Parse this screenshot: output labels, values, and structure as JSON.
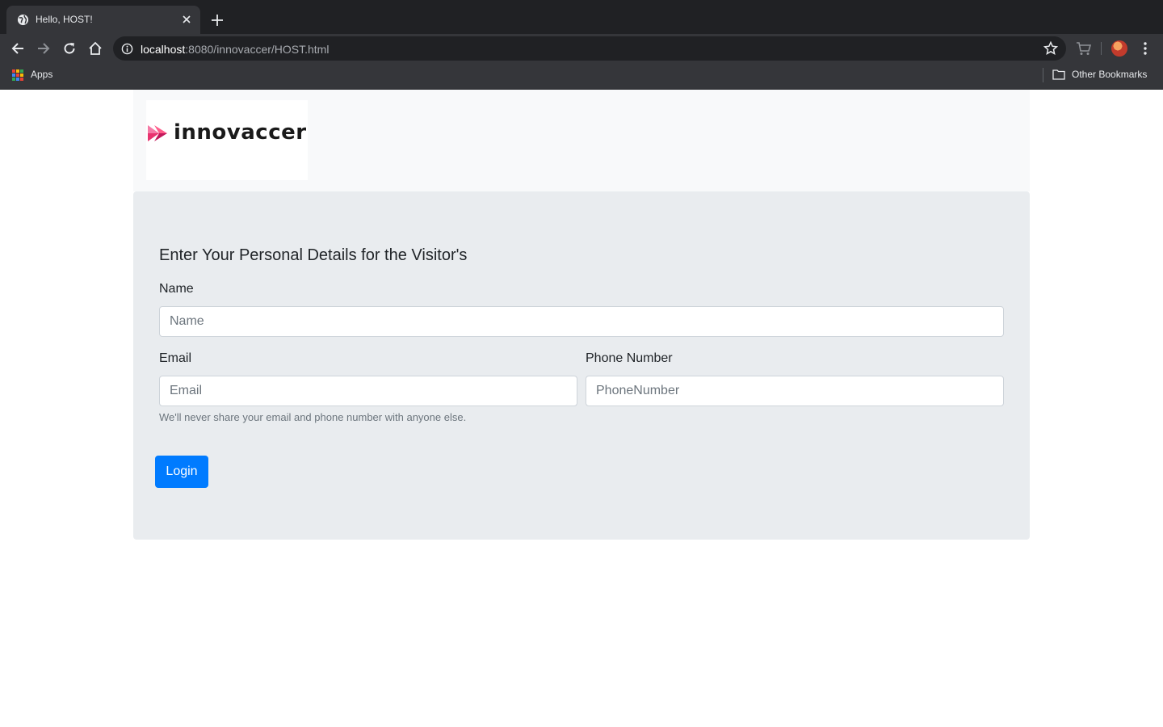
{
  "browser": {
    "tab_title": "Hello, HOST!",
    "url_host": "localhost",
    "url_path": ":8080/innovaccer/HOST.html",
    "bookmarks_apps_label": "Apps",
    "other_bookmarks_label": "Other Bookmarks"
  },
  "page": {
    "logo_text": "innovaccer",
    "form_title": "Enter Your Personal Details for the Visitor's",
    "name": {
      "label": "Name",
      "placeholder": "Name",
      "value": ""
    },
    "email": {
      "label": "Email",
      "placeholder": "Email",
      "value": ""
    },
    "phone": {
      "label": "Phone Number",
      "placeholder": "PhoneNumber",
      "value": ""
    },
    "help_text": "We'll never share your email and phone number with anyone else.",
    "login_button": "Login"
  },
  "colors": {
    "primary": "#007bff",
    "logo_accent": "#e8336f",
    "jumbotron_bg": "#e9ecef"
  }
}
